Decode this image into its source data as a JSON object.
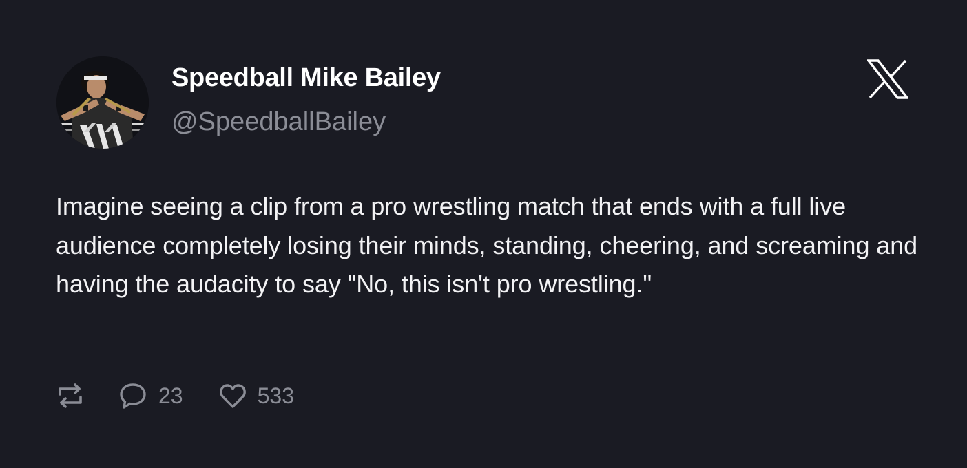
{
  "author": {
    "name": "Speedball Mike Bailey",
    "handle": "@SpeedballBailey",
    "avatar_icon": "profile-photo-wrestler"
  },
  "platform_icon": "x-logo-icon",
  "tweet": {
    "text": "Imagine seeing a clip from a pro wrestling match that ends with a full live audience completely losing their minds, standing, cheering, and screaming and having the audacity to say \"No, this isn't pro wrestling.\""
  },
  "actions": {
    "retweet_icon": "retweet-icon",
    "reply_icon": "reply-icon",
    "reply_count": "23",
    "like_icon": "heart-icon",
    "like_count": "533"
  },
  "colors": {
    "background": "#1a1b23",
    "text_primary": "#f2f2f4",
    "text_secondary": "#8b8d96"
  }
}
